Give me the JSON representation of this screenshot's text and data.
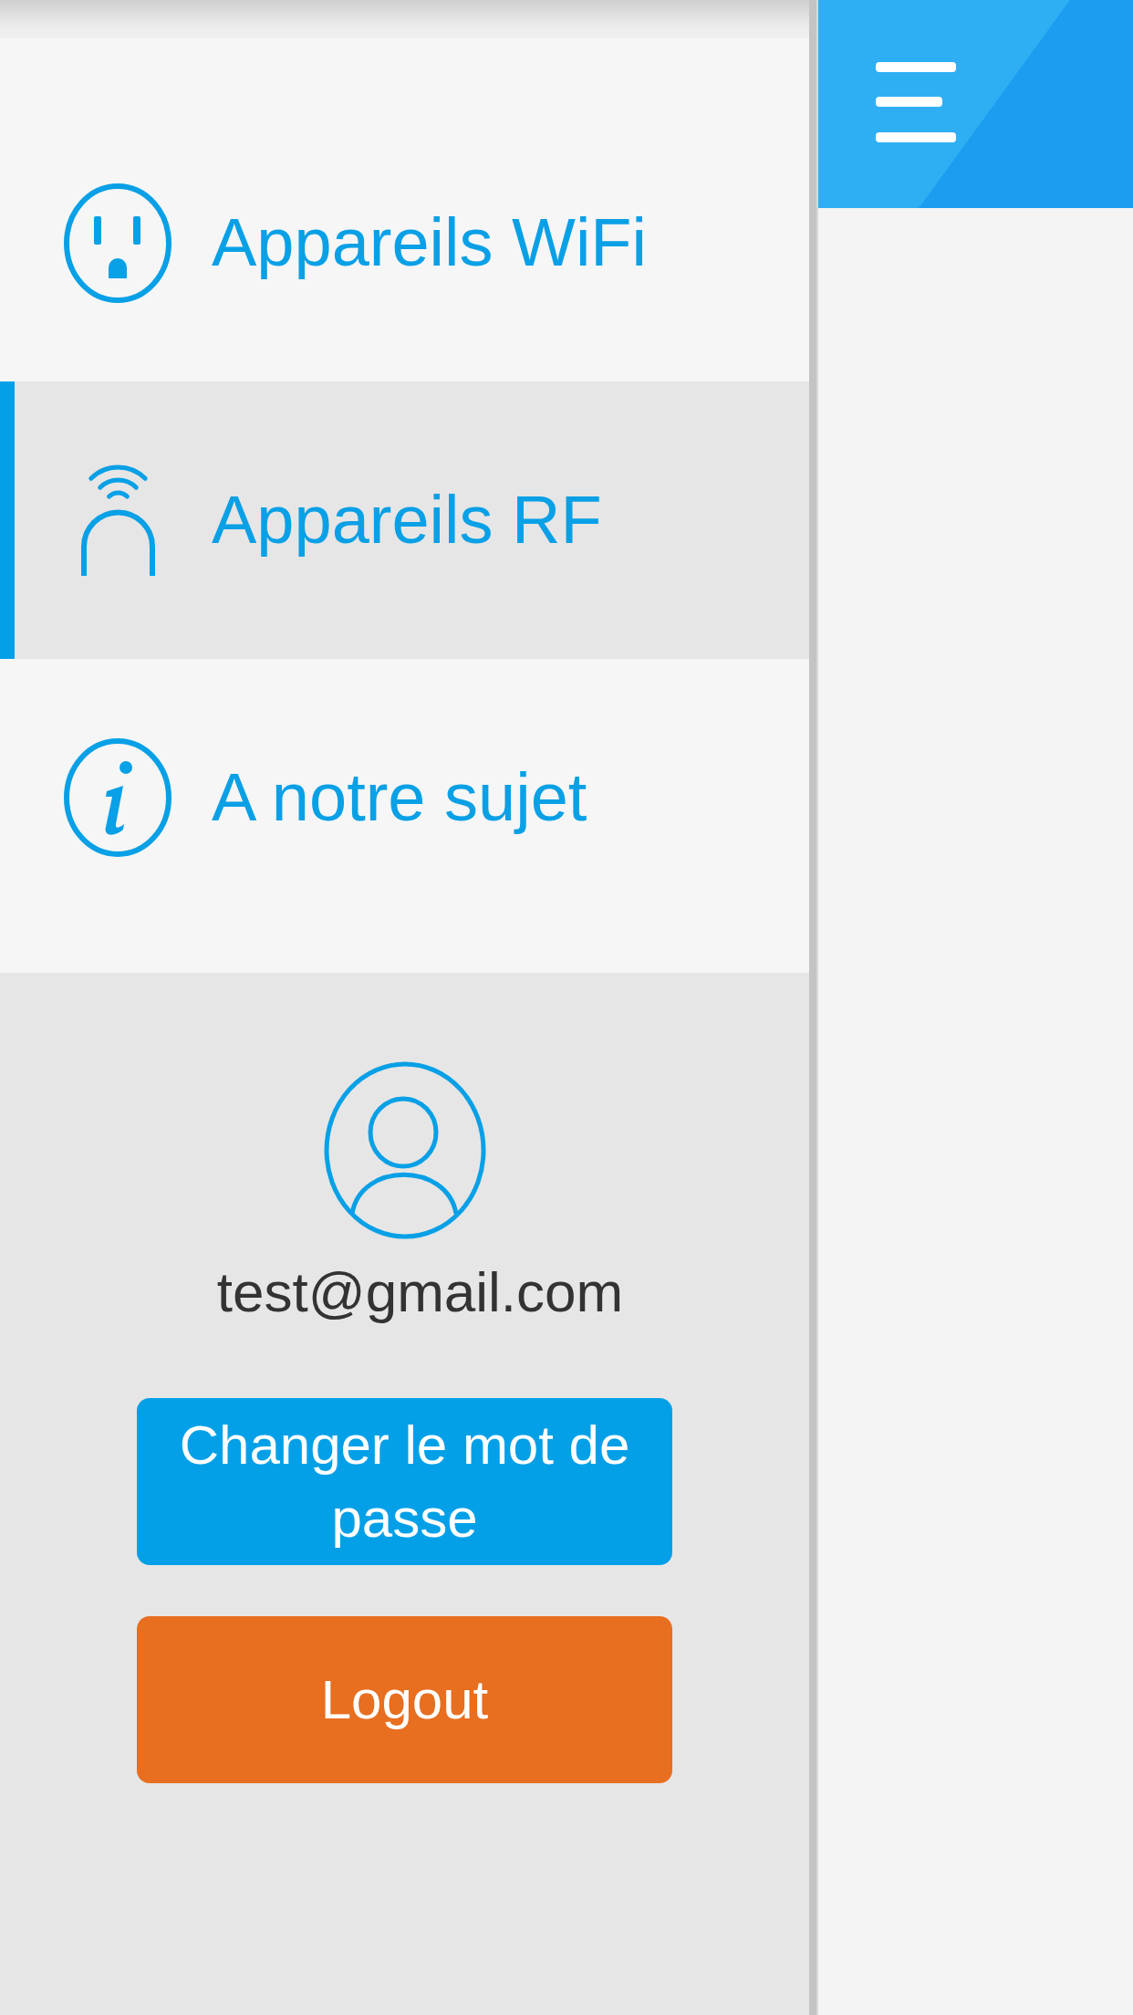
{
  "drawer": {
    "items": [
      {
        "label": "Appareils WiFi",
        "selected": false
      },
      {
        "label": "Appareils RF",
        "selected": true
      },
      {
        "label": "A notre sujet",
        "selected": false
      }
    ]
  },
  "profile": {
    "email": "test@gmail.com",
    "buttons": [
      {
        "label": "Changer le mot de passe",
        "kind": "primary"
      },
      {
        "label": "Logout",
        "kind": "danger"
      }
    ]
  }
}
